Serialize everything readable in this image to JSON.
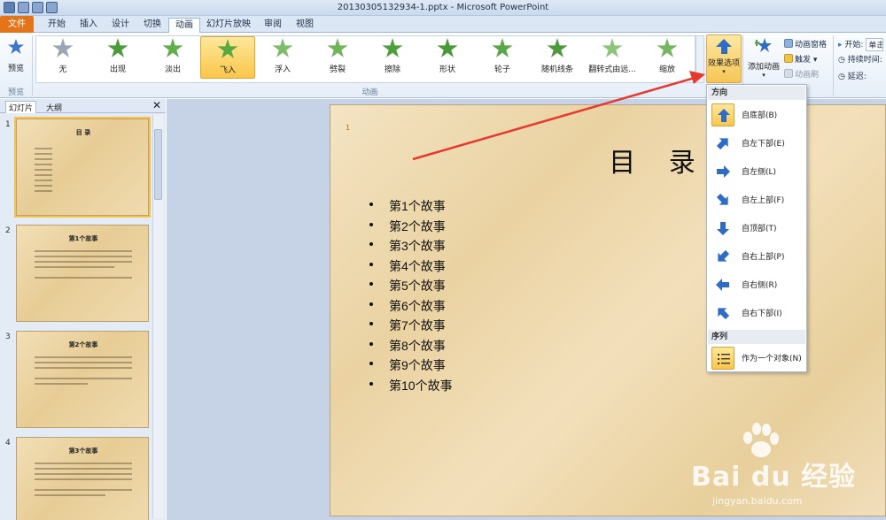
{
  "window": {
    "title": "20130305132934-1.pptx - Microsoft PowerPoint"
  },
  "tabs": [
    "文件",
    "开始",
    "插入",
    "设计",
    "切换",
    "动画",
    "幻灯片放映",
    "审阅",
    "视图"
  ],
  "ribbon": {
    "preview_label": "预览",
    "preview_group": "预览",
    "animation_group": "动画",
    "effects": [
      {
        "label": "无",
        "color": "#9aa6b4"
      },
      {
        "label": "出现",
        "color": "#4d9a3a"
      },
      {
        "label": "淡出",
        "color": "#5fae4a"
      },
      {
        "label": "飞入",
        "color": "#58a742"
      },
      {
        "label": "浮入",
        "color": "#7dbd6a"
      },
      {
        "label": "劈裂",
        "color": "#6db558"
      },
      {
        "label": "擦除",
        "color": "#4f9e3c"
      },
      {
        "label": "形状",
        "color": "#4a9a3a"
      },
      {
        "label": "轮子",
        "color": "#5aa648"
      },
      {
        "label": "随机线条",
        "color": "#4c9a3b"
      },
      {
        "label": "翻转式由远...",
        "color": "#8cc47a"
      },
      {
        "label": "缩放",
        "color": "#76b562"
      }
    ],
    "selected_effect": "飞入",
    "effect_options_label": "效果选项",
    "add_animation_label": "添加动画",
    "animation_pane_label": "动画窗格",
    "trigger_label": "触发",
    "painter_label": "动画刷",
    "start_label": "开始:",
    "start_value": "单击",
    "duration_label": "持续时间:",
    "delay_label": "延迟:"
  },
  "left_pane": {
    "tab_slides": "幻灯片",
    "tab_outline": "大纲",
    "thumbs": [
      {
        "num": "1",
        "title": "目 录"
      },
      {
        "num": "2",
        "title": "第1个故事"
      },
      {
        "num": "3",
        "title": "第2个故事"
      },
      {
        "num": "4",
        "title": "第3个故事"
      }
    ]
  },
  "slide": {
    "title": "目 录",
    "anim_marker": "1",
    "items": [
      "第1个故事",
      "第2个故事",
      "第3个故事",
      "第4个故事",
      "第5个故事",
      "第6个故事",
      "第7个故事",
      "第8个故事",
      "第9个故事",
      "第10个故事"
    ]
  },
  "dropdown": {
    "direction_header": "方向",
    "directions": [
      {
        "label": "自底部(B)",
        "dir": "up",
        "selected": true
      },
      {
        "label": "自左下部(E)",
        "dir": "up-right",
        "selected": false
      },
      {
        "label": "自左侧(L)",
        "dir": "right",
        "selected": false
      },
      {
        "label": "自左上部(F)",
        "dir": "down-right",
        "selected": false
      },
      {
        "label": "自顶部(T)",
        "dir": "down",
        "selected": false
      },
      {
        "label": "自右上部(P)",
        "dir": "down-left",
        "selected": false
      },
      {
        "label": "自右侧(R)",
        "dir": "left",
        "selected": false
      },
      {
        "label": "自右下部(I)",
        "dir": "up-left",
        "selected": false
      }
    ],
    "sequence_header": "序列",
    "sequence_item": "作为一个对象(N)"
  },
  "watermark": {
    "text": "Bai du 经验",
    "url": "jingyan.baidu.com"
  },
  "colors": {
    "accent": "#2f6cc4",
    "file_tab": "#e3741a",
    "selection": "#f9c64a",
    "red_arrow": "#e8392f"
  }
}
